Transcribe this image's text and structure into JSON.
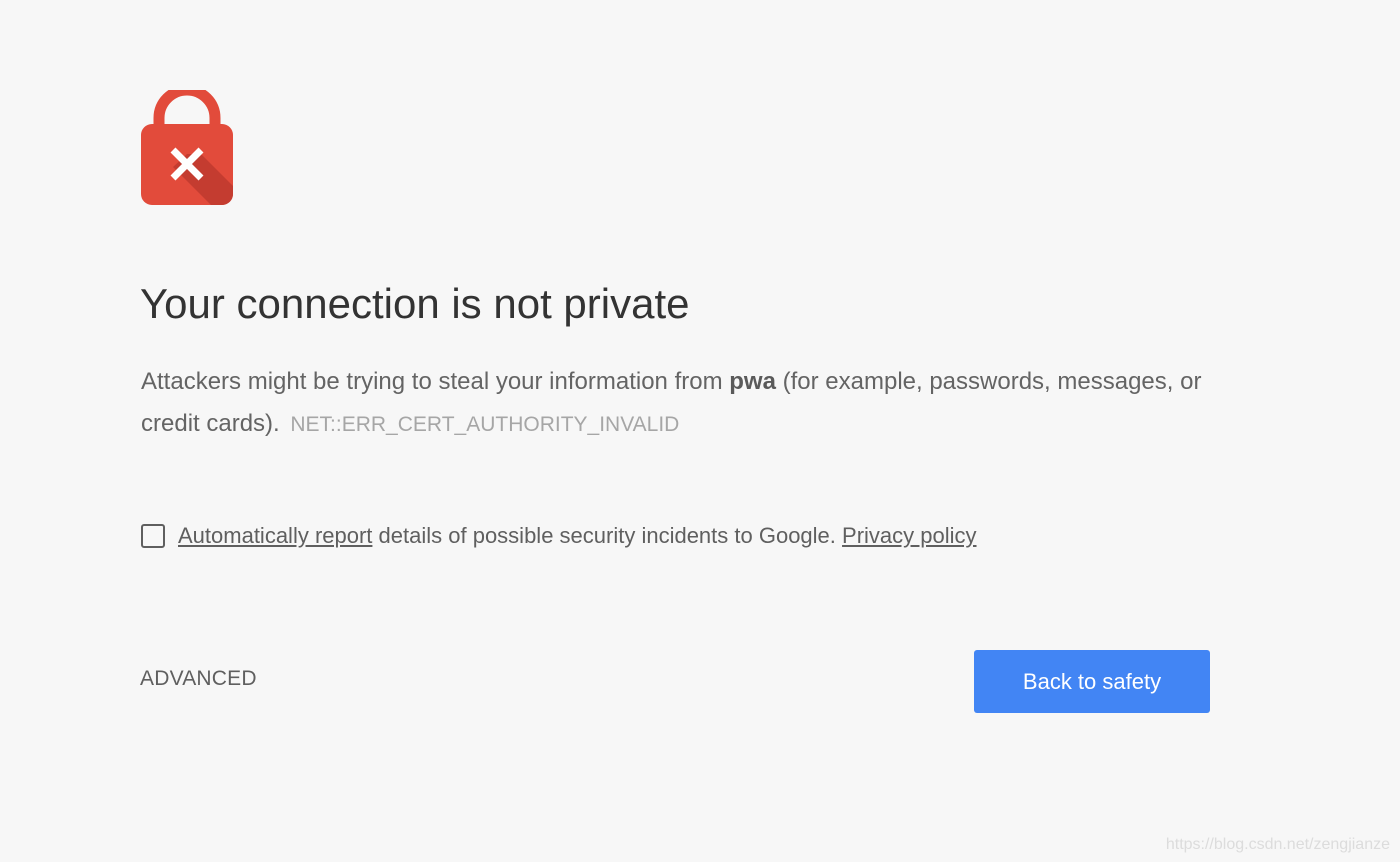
{
  "icon": "lock-error-icon",
  "colors": {
    "background": "#f7f7f7",
    "lock": "#e24b3b",
    "lock_shadow": "#c43c30",
    "heading": "#333333",
    "body_text": "#646464",
    "error_code": "#a6a6a6",
    "primary_button": "#4285f4"
  },
  "heading": "Your connection is not private",
  "main_message": {
    "before_host": "Attackers might be trying to steal your information from",
    "host": "pwa",
    "after_host": "(for example, passwords, messages, or credit cards).",
    "error_code": "NET::ERR_CERT_AUTHORITY_INVALID"
  },
  "report": {
    "checked": false,
    "link_label": "Automatically report",
    "text": "details of possible security incidents to Google.",
    "privacy_link": "Privacy policy"
  },
  "buttons": {
    "advanced": "ADVANCED",
    "primary": "Back to safety"
  },
  "watermark": "https://blog.csdn.net/zengjianze"
}
